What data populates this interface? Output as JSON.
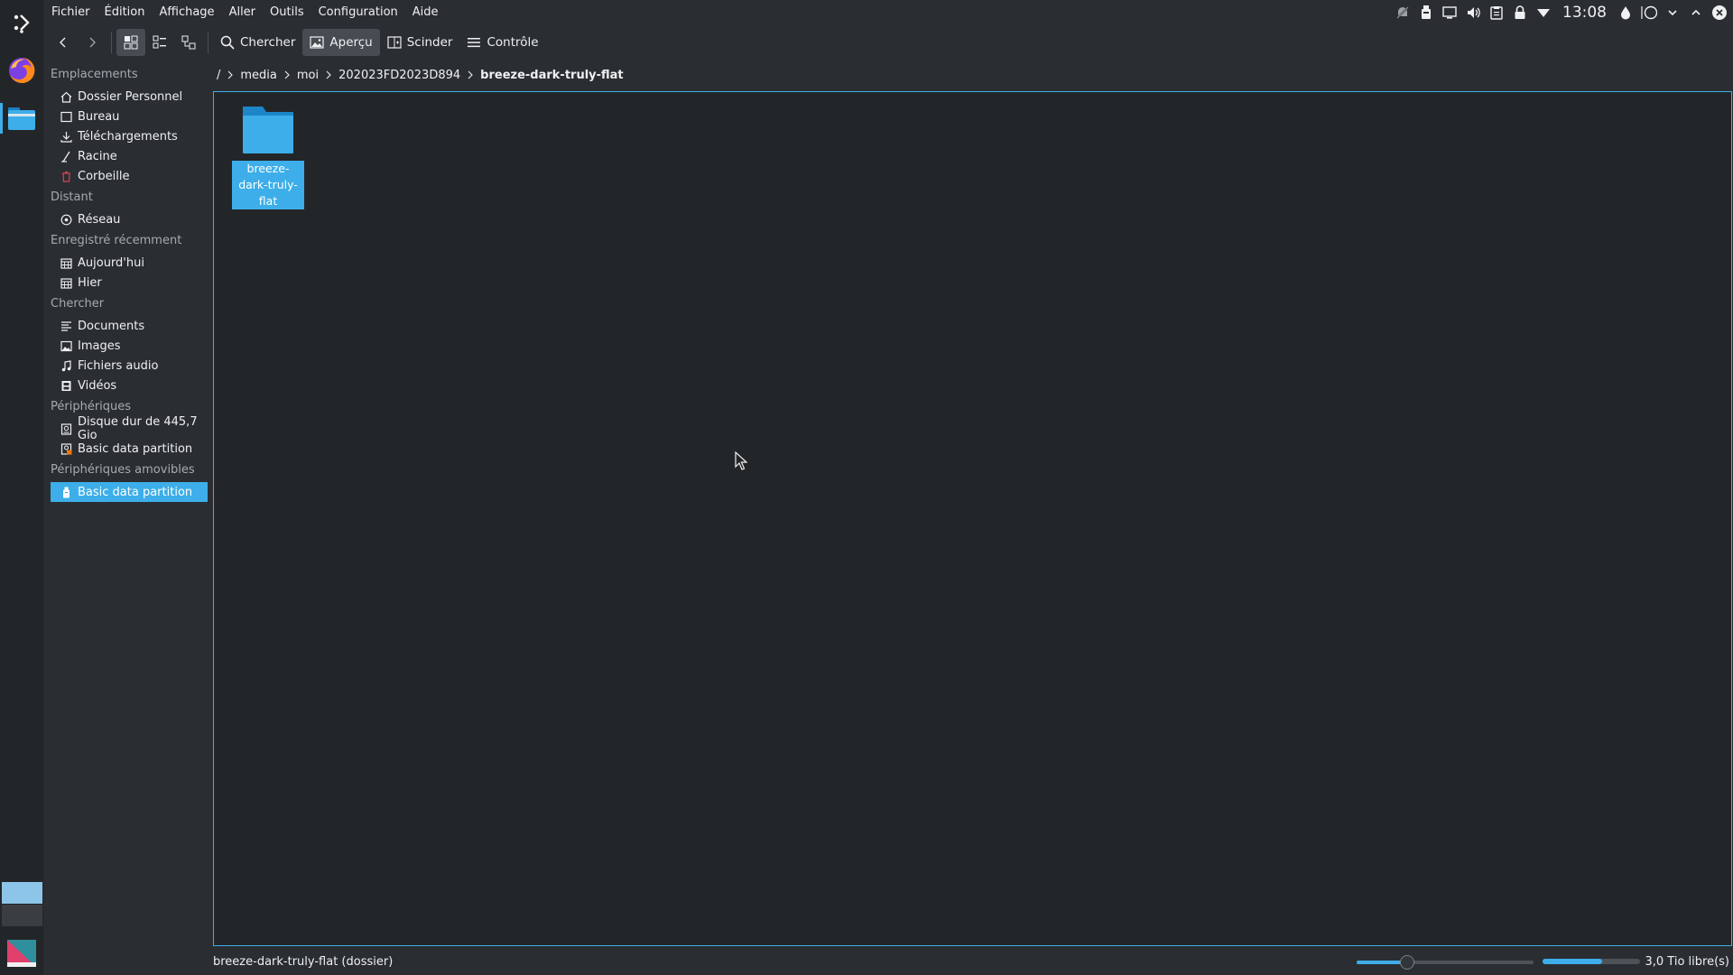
{
  "colors": {
    "accent": "#3daee9",
    "background": "#2a2e32",
    "view_background": "#232629",
    "text": "#eff0f1",
    "muted": "#a6abb0"
  },
  "menubar": {
    "items": [
      {
        "label": "Fichier"
      },
      {
        "label": "Édition"
      },
      {
        "label": "Affichage"
      },
      {
        "label": "Aller"
      },
      {
        "label": "Outils"
      },
      {
        "label": "Configuration"
      },
      {
        "label": "Aide"
      }
    ]
  },
  "tray": {
    "clock": "13:08"
  },
  "toolbar": {
    "search_label": "Chercher",
    "preview_label": "Aperçu",
    "split_label": "Scinder",
    "control_label": "Contrôle"
  },
  "places": {
    "groups": [
      {
        "title": "Emplacements",
        "items": [
          {
            "label": "Dossier Personnel",
            "icon": "home-icon"
          },
          {
            "label": "Bureau",
            "icon": "desktop-icon"
          },
          {
            "label": "Téléchargements",
            "icon": "download-icon"
          },
          {
            "label": "Racine",
            "icon": "root-icon"
          },
          {
            "label": "Corbeille",
            "icon": "trash-icon"
          }
        ]
      },
      {
        "title": "Distant",
        "items": [
          {
            "label": "Réseau",
            "icon": "network-icon"
          }
        ]
      },
      {
        "title": "Enregistré récemment",
        "items": [
          {
            "label": "Aujourd'hui",
            "icon": "calendar-icon"
          },
          {
            "label": "Hier",
            "icon": "calendar-icon"
          }
        ]
      },
      {
        "title": "Chercher",
        "items": [
          {
            "label": "Documents",
            "icon": "document-icon"
          },
          {
            "label": "Images",
            "icon": "image-icon"
          },
          {
            "label": "Fichiers audio",
            "icon": "music-icon"
          },
          {
            "label": "Vidéos",
            "icon": "video-icon"
          }
        ]
      },
      {
        "title": "Périphériques",
        "items": [
          {
            "label": "Disque dur de 445,7 Gio",
            "icon": "harddisk-icon"
          },
          {
            "label": "Basic data partition",
            "icon": "harddisk-locked-icon"
          }
        ]
      },
      {
        "title": "Périphériques amovibles",
        "items": [
          {
            "label": "Basic data partition",
            "icon": "usb-drive-icon",
            "selected": true
          }
        ]
      }
    ]
  },
  "breadcrumb": {
    "root": "/",
    "parts": [
      "media",
      "moi",
      "202023FD2023D894"
    ],
    "current": "breeze-dark-truly-flat"
  },
  "view": {
    "items": [
      {
        "name": "breeze-dark-truly-flat",
        "type": "folder",
        "selected": true
      }
    ]
  },
  "statusbar": {
    "text": "breeze-dark-truly-flat (dossier)",
    "zoom_fraction": 0.27,
    "used_fraction": 0.62,
    "free_space": "3,0 Tio libre(s)"
  }
}
